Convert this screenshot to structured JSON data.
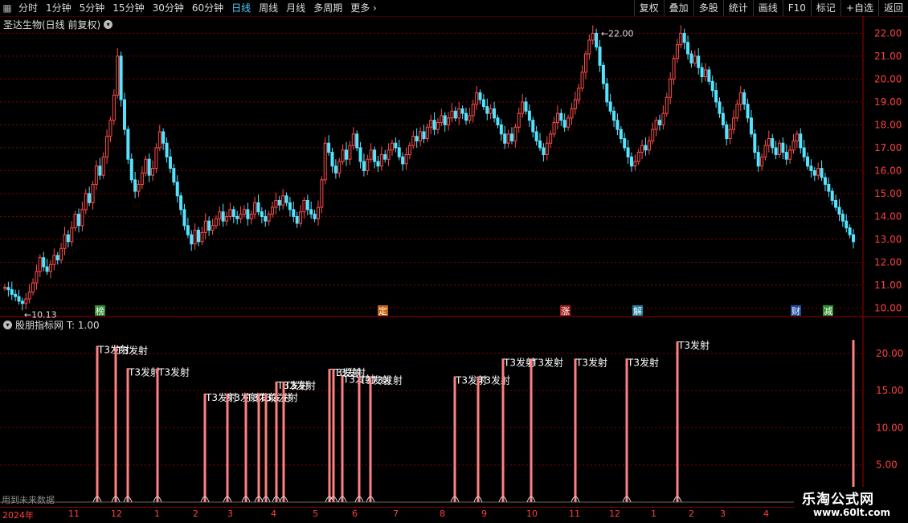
{
  "toolbar": {
    "periods": [
      "分时",
      "1分钟",
      "5分钟",
      "15分钟",
      "30分钟",
      "60分钟",
      "日线",
      "周线",
      "月线",
      "多周期",
      "更多"
    ],
    "active_period": "日线",
    "buttons": [
      "复权",
      "叠加",
      "多股",
      "统计",
      "画线",
      "F10",
      "标记",
      "+自选",
      "返回"
    ]
  },
  "main": {
    "title": "圣达生物(日线 前复权)",
    "high_label": "22.00",
    "low_label": "10.13",
    "y_ticks": [
      "22.00",
      "21.00",
      "20.00",
      "19.00",
      "18.00",
      "17.00",
      "16.00",
      "15.00",
      "14.00",
      "13.00",
      "12.00",
      "11.00",
      "10.00"
    ],
    "events": [
      "榜",
      "定",
      "涨",
      "解",
      "财",
      "减"
    ]
  },
  "sub": {
    "title": "股朋指标网",
    "t_label": "T: 1.00",
    "signal_label": "T3发射",
    "y_ticks": [
      "20.00",
      "15.00",
      "10.00",
      "5.00"
    ],
    "note": "用到未来数据"
  },
  "xaxis": {
    "year": "2024年",
    "months": [
      "11",
      "12",
      "1",
      "2",
      "3",
      "4",
      "5",
      "6",
      "7",
      "8",
      "9",
      "10",
      "11",
      "12",
      "1",
      "2",
      "3",
      "4"
    ]
  },
  "watermark": {
    "line1": "乐淘公式网",
    "line2": "www.60lt.com"
  },
  "colors": {
    "up": "#ff4d4d",
    "down": "#54e4ff",
    "grid": "#8a0000",
    "signal": "#ff8080",
    "bg": "#000000"
  },
  "chart_data": {
    "type": "candlestick",
    "price_range": [
      9.7,
      22.4
    ],
    "closes": [
      10.9,
      10.8,
      10.6,
      10.5,
      10.3,
      10.2,
      10.4,
      10.7,
      11.1,
      11.6,
      12.2,
      11.8,
      11.6,
      11.9,
      12.3,
      12.1,
      12.6,
      13.2,
      12.9,
      13.5,
      14.1,
      13.6,
      14.3,
      15.0,
      14.6,
      15.4,
      16.2,
      15.8,
      16.6,
      17.5,
      18.2,
      19.3,
      21.0,
      19.1,
      17.8,
      16.5,
      15.6,
      15.1,
      15.4,
      15.9,
      16.5,
      15.8,
      16.1,
      17.0,
      17.7,
      17.2,
      16.6,
      16.1,
      15.5,
      14.9,
      14.3,
      13.6,
      13.2,
      12.8,
      13.4,
      12.9,
      13.3,
      13.8,
      13.4,
      13.6,
      13.9,
      14.2,
      13.8,
      14.0,
      14.3,
      14.0,
      13.9,
      14.1,
      14.3,
      13.9,
      14.1,
      14.6,
      14.2,
      14.0,
      13.8,
      14.1,
      14.4,
      14.7,
      14.5,
      14.9,
      14.6,
      14.3,
      14.0,
      13.7,
      14.2,
      14.7,
      14.3,
      14.1,
      13.9,
      14.4,
      15.6,
      17.2,
      16.8,
      16.2,
      15.9,
      16.4,
      16.9,
      16.5,
      17.1,
      17.6,
      17.0,
      16.4,
      16.0,
      16.5,
      16.9,
      16.4,
      16.2,
      16.7,
      16.5,
      16.9,
      17.2,
      17.0,
      16.6,
      16.3,
      16.7,
      17.1,
      17.5,
      17.3,
      17.7,
      17.4,
      17.9,
      18.2,
      17.8,
      18.1,
      18.4,
      18.0,
      18.3,
      18.6,
      18.3,
      18.7,
      18.5,
      18.2,
      18.4,
      18.9,
      19.4,
      19.1,
      18.8,
      18.5,
      18.7,
      18.3,
      18.0,
      17.6,
      17.2,
      17.6,
      17.3,
      17.9,
      18.5,
      19.0,
      18.6,
      18.2,
      17.7,
      17.3,
      17.0,
      16.7,
      17.2,
      17.6,
      18.1,
      18.5,
      18.2,
      17.9,
      18.3,
      18.7,
      19.1,
      19.6,
      20.3,
      21.1,
      21.7,
      22.0,
      21.4,
      20.6,
      19.8,
      19.0,
      18.6,
      18.2,
      17.8,
      17.4,
      17.0,
      16.6,
      16.2,
      16.4,
      16.8,
      17.1,
      16.9,
      17.3,
      17.8,
      18.2,
      18.0,
      18.5,
      19.2,
      20.0,
      20.9,
      21.5,
      22.0,
      21.6,
      21.1,
      20.7,
      21.0,
      20.5,
      20.1,
      20.4,
      19.9,
      19.5,
      19.0,
      18.5,
      18.0,
      17.4,
      17.8,
      18.3,
      18.9,
      19.4,
      18.9,
      18.3,
      17.6,
      16.8,
      16.2,
      16.6,
      17.1,
      17.4,
      17.0,
      16.7,
      17.2,
      16.8,
      16.5,
      16.9,
      17.3,
      17.6,
      17.0,
      16.6,
      16.2,
      16.0,
      15.8,
      16.1,
      15.7,
      15.4,
      15.1,
      14.7,
      14.4,
      14.1,
      13.8,
      13.5,
      13.2,
      12.9
    ],
    "signal_values": [
      21.0,
      20.9,
      18.0,
      18.0,
      14.6,
      14.6,
      14.6,
      14.6,
      14.6,
      16.2,
      16.2,
      17.9,
      17.9,
      17.0,
      16.9,
      16.9,
      16.9,
      16.9,
      19.3,
      19.3,
      19.3,
      19.3,
      21.6,
      21.6,
      21.6,
      21.8
    ]
  }
}
